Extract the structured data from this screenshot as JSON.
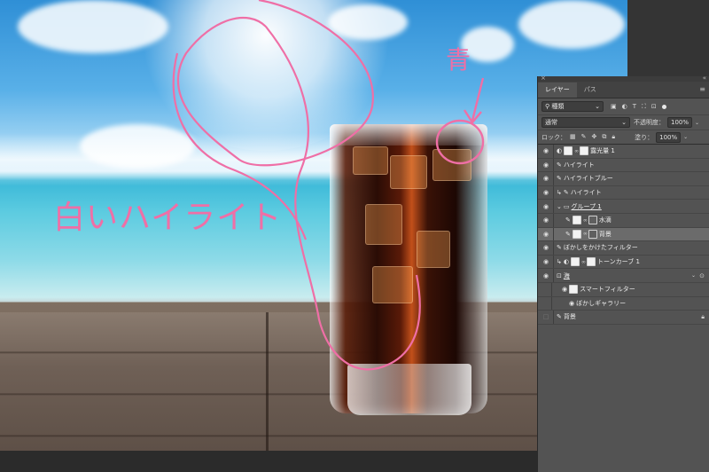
{
  "annotations": {
    "white_highlight": "白いハイライト",
    "blue": "青"
  },
  "panel": {
    "tabs": [
      {
        "label": "レイヤー",
        "active": true
      },
      {
        "label": "パス",
        "active": false
      }
    ],
    "filter": {
      "value": "種類"
    },
    "blend": {
      "mode": "通常",
      "opacity_label": "不透明度：",
      "opacity_value": "100%"
    },
    "lock": {
      "label": "ロック：",
      "fill_label": "塗り：",
      "fill_value": "100%"
    },
    "layers": [
      {
        "name": "露光量 1",
        "icon": "adjustment-icon",
        "visible": true
      },
      {
        "name": "ハイライト",
        "icon": "brush-icon",
        "visible": true
      },
      {
        "name": "ハイライトブルー",
        "icon": "brush-icon",
        "visible": true
      },
      {
        "name": "ハイライト",
        "icon": "brush-icon",
        "visible": true,
        "clipped": true
      },
      {
        "name": "グループ 1",
        "icon": "folder-icon",
        "visible": true,
        "expanded": true
      },
      {
        "name": "水滴",
        "icon": "brush-icon",
        "visible": true,
        "nested": true
      },
      {
        "name": "背景",
        "icon": "brush-icon",
        "visible": true,
        "nested": true,
        "selected": true
      },
      {
        "name": "ぼかしをかけたフィルター",
        "icon": "brush-icon",
        "visible": true
      },
      {
        "name": "トーンカーブ 1",
        "icon": "adjustment-icon",
        "visible": true,
        "clipped": true
      },
      {
        "name": "海",
        "icon": "smart-object-icon",
        "visible": true
      },
      {
        "name": "スマートフィルター",
        "icon": "filter-mask-icon",
        "visible": true,
        "sub": true
      },
      {
        "name": "ぼかしギャラリー",
        "icon": "filter-icon",
        "visible": true,
        "sub2": true
      },
      {
        "name": "背景",
        "icon": "brush-icon",
        "visible": false,
        "locked": true
      }
    ]
  },
  "colors": {
    "annotation": "#ef6fa6",
    "panel_bg": "#535353",
    "selected_row": "#6b6b6b"
  }
}
